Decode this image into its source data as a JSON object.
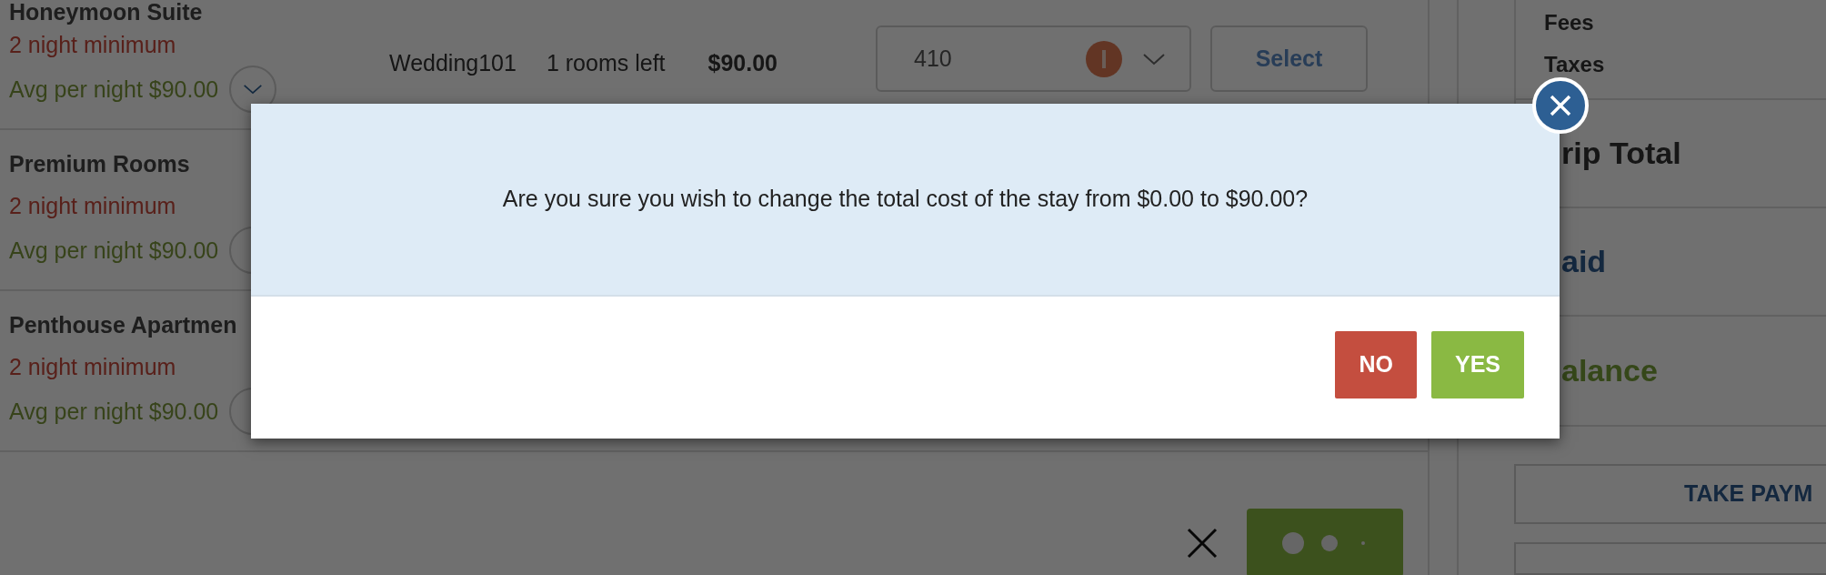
{
  "rooms": [
    {
      "name": "Honeymoon Suite",
      "minimum": "2 night minimum",
      "average": "Avg per night $90.00",
      "offer": {
        "code": "Wedding101",
        "availability": "1 rooms left",
        "price": "$90.00",
        "room_number": "410",
        "button": "Select"
      }
    },
    {
      "name": "Premium Rooms",
      "minimum": "2 night minimum",
      "average": "Avg per night $90.00"
    },
    {
      "name": "Penthouse Apartmen",
      "minimum": "2 night minimum",
      "average": "Avg per night $90.00"
    }
  ],
  "summary": {
    "charges": [
      "Fees",
      "Taxes"
    ],
    "totals": [
      {
        "kind": "total",
        "label": "rip Total"
      },
      {
        "kind": "paid",
        "label": "aid"
      },
      {
        "kind": "balance",
        "label": "alance"
      }
    ],
    "payment_button": "TAKE PAYM"
  },
  "dialog": {
    "message": "Are you sure you wish to change the total cost of the stay from $0.00 to $90.00?",
    "buttons": [
      {
        "kind": "no",
        "label": "NO"
      },
      {
        "kind": "yes",
        "label": "YES"
      }
    ]
  }
}
